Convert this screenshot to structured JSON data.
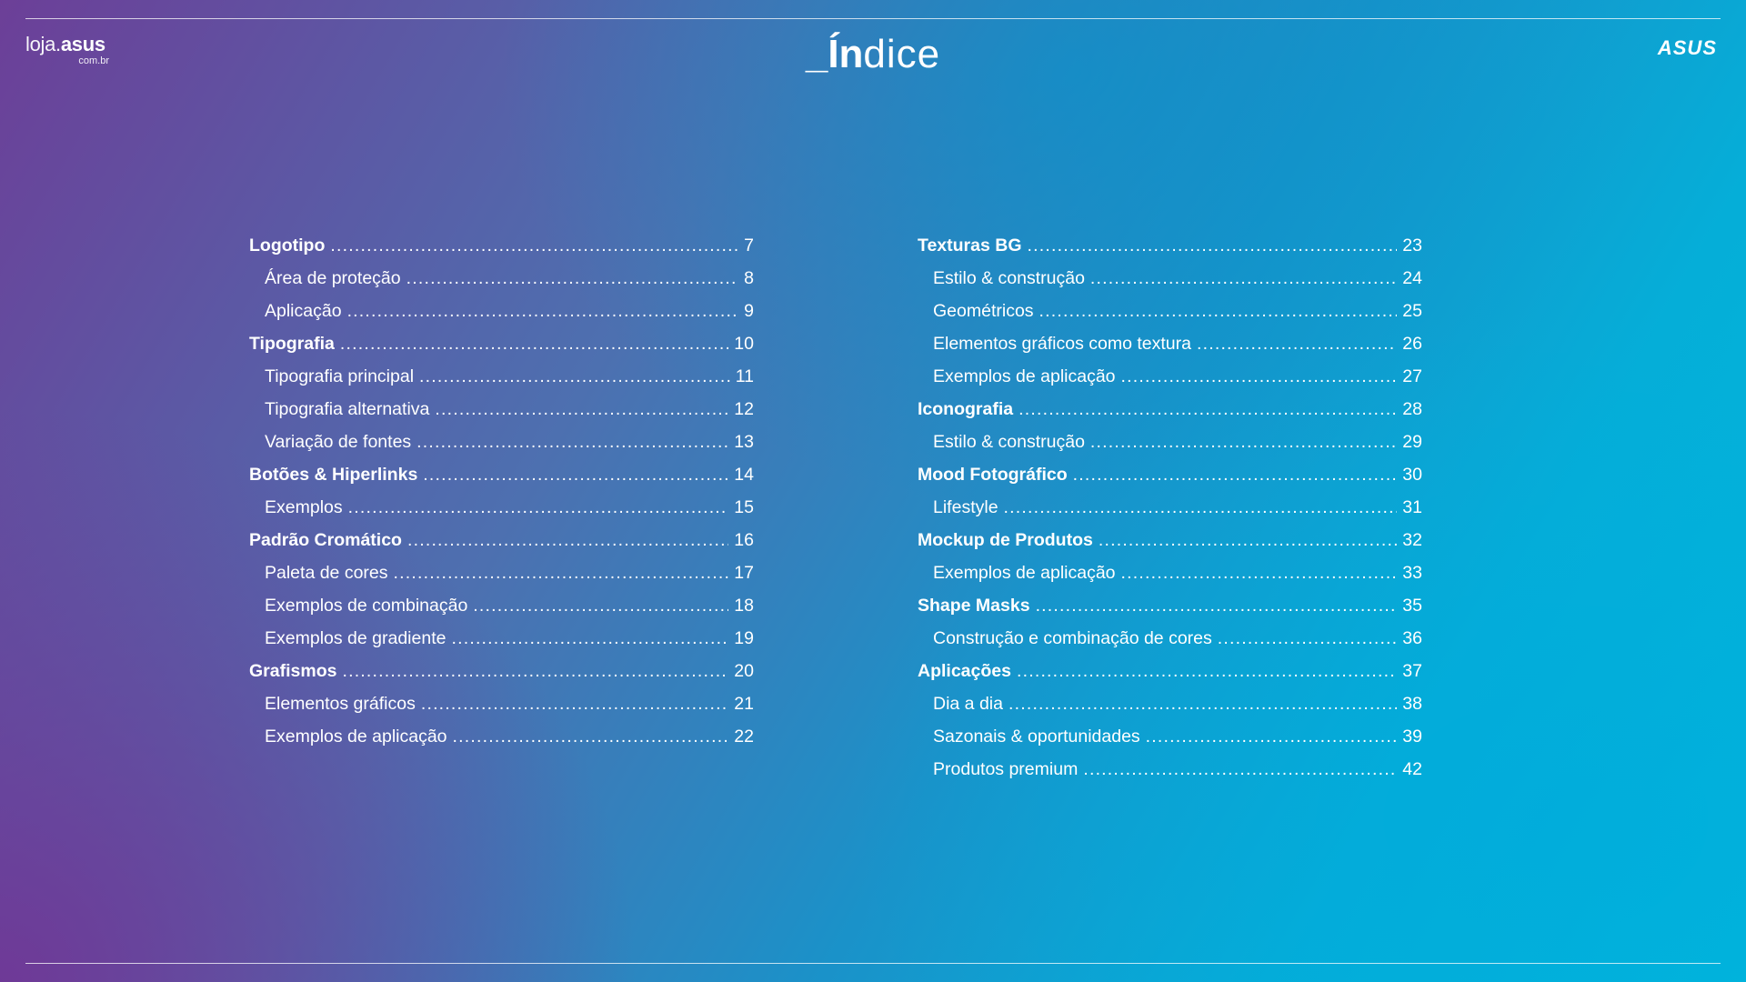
{
  "header": {
    "store_logo": {
      "prefix": "loja.",
      "name": "asus",
      "suffix": "com.br"
    },
    "title_prefix": "_Ín",
    "title_rest": "dice",
    "brand_logo": "ASUS"
  },
  "index_left": [
    {
      "label": "Logotipo",
      "page": "7",
      "level": "main"
    },
    {
      "label": "Área de proteção",
      "page": "8",
      "level": "sub"
    },
    {
      "label": "Aplicação",
      "page": "9",
      "level": "sub"
    },
    {
      "label": "Tipografia",
      "page": "10",
      "level": "main"
    },
    {
      "label": "Tipografia principal",
      "page": "11",
      "level": "sub"
    },
    {
      "label": "Tipografia alternativa",
      "page": "12",
      "level": "sub"
    },
    {
      "label": "Variação de fontes",
      "page": "13",
      "level": "sub"
    },
    {
      "label": "Botões & Hiperlinks",
      "page": "14",
      "level": "main"
    },
    {
      "label": "Exemplos",
      "page": "15",
      "level": "sub"
    },
    {
      "label": "Padrão Cromático",
      "page": "16",
      "level": "main"
    },
    {
      "label": "Paleta de cores",
      "page": "17",
      "level": "sub"
    },
    {
      "label": "Exemplos de combinação",
      "page": "18",
      "level": "sub"
    },
    {
      "label": "Exemplos de gradiente",
      "page": "19",
      "level": "sub"
    },
    {
      "label": "Grafismos",
      "page": "20",
      "level": "main"
    },
    {
      "label": "Elementos gráficos",
      "page": "21",
      "level": "sub"
    },
    {
      "label": "Exemplos de aplicação",
      "page": "22",
      "level": "sub"
    }
  ],
  "index_right": [
    {
      "label": "Texturas BG",
      "page": "23",
      "level": "main"
    },
    {
      "label": "Estilo & construção",
      "page": "24",
      "level": "sub"
    },
    {
      "label": "Geométricos",
      "page": "25",
      "level": "sub"
    },
    {
      "label": "Elementos gráficos como textura",
      "page": "26",
      "level": "sub"
    },
    {
      "label": "Exemplos de aplicação",
      "page": "27",
      "level": "sub"
    },
    {
      "label": "Iconografia",
      "page": "28",
      "level": "main"
    },
    {
      "label": "Estilo & construção",
      "page": "29",
      "level": "sub"
    },
    {
      "label": "Mood Fotográfico",
      "page": "30",
      "level": "main"
    },
    {
      "label": "Lifestyle",
      "page": "31",
      "level": "sub"
    },
    {
      "label": "Mockup de Produtos",
      "page": "32",
      "level": "main"
    },
    {
      "label": "Exemplos de aplicação",
      "page": "33",
      "level": "sub"
    },
    {
      "label": "Shape Masks",
      "page": "35",
      "level": "main"
    },
    {
      "label": "Construção e combinação de cores",
      "page": "36",
      "level": "sub"
    },
    {
      "label": "Aplicações",
      "page": "37",
      "level": "main"
    },
    {
      "label": "Dia a dia",
      "page": "38",
      "level": "sub"
    },
    {
      "label": "Sazonais & oportunidades",
      "page": "39",
      "level": "sub"
    },
    {
      "label": "Produtos premium",
      "page": "42",
      "level": "sub"
    }
  ],
  "colors": {
    "gradient_start": "#6c3f98",
    "gradient_mid": "#1a92c9",
    "gradient_end": "#00b8dc",
    "text": "#ffffff"
  }
}
